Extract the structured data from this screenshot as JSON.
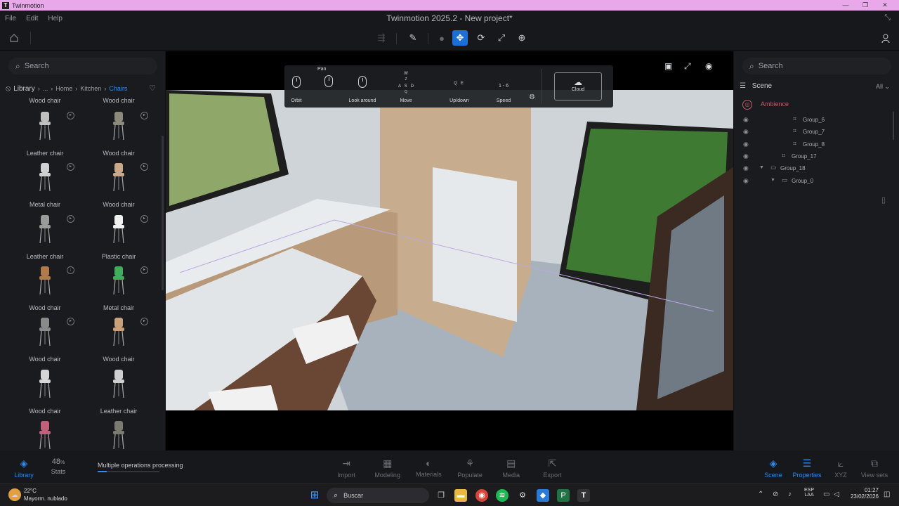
{
  "window": {
    "app_name": "Twinmotion",
    "title": "Twinmotion 2025.2 - New project*",
    "app_icon_letter": "T"
  },
  "menu": [
    "File",
    "Edit",
    "Help"
  ],
  "left_panel": {
    "search_placeholder": "Search",
    "breadcrumb": {
      "library": "Library",
      "ellipsis": "...",
      "home": "Home",
      "kitchen": "Kitchen",
      "current": "Chairs"
    },
    "top_row_labels": [
      "Wood chair",
      "Wood chair"
    ],
    "assets": [
      {
        "name": "Leather chair",
        "color": "#bfbfbf"
      },
      {
        "name": "Wood chair",
        "color": "#8c8a7a"
      },
      {
        "name": "Metal chair",
        "color": "#d0d0d0"
      },
      {
        "name": "Wood chair",
        "color": "#c9a98a"
      },
      {
        "name": "Leather chair",
        "color": "#9a9a9a"
      },
      {
        "name": "Plastic chair",
        "color": "#f1f1f1"
      },
      {
        "name": "Wood chair",
        "color": "#b07a4a"
      },
      {
        "name": "Metal chair",
        "color": "#3fae5a"
      },
      {
        "name": "Wood chair",
        "color": "#8a8a8a"
      },
      {
        "name": "Wood chair",
        "color": "#c8a07a"
      },
      {
        "name": "Wood chair",
        "color": "#d6d6d6"
      },
      {
        "name": "Leather chair",
        "color": "#cfcfcf"
      },
      {
        "name": "",
        "color": "#c0607a"
      },
      {
        "name": "",
        "color": "#7a7a70"
      }
    ]
  },
  "viewport": {
    "nav_hud": {
      "pan": "Pan",
      "orbit": "Orbit",
      "look_around": "Look around",
      "move": "Move",
      "updown": "Up/down",
      "speed": "Speed",
      "speed_value": "1 - 6",
      "cloud": "Cloud",
      "move_keys": [
        "W",
        "A",
        "S",
        "D",
        "Z",
        "Q"
      ],
      "updown_keys": [
        "Q",
        "E"
      ]
    }
  },
  "right_panel": {
    "search_placeholder": "Search",
    "scene_title": "Scene",
    "filter": "All",
    "ambience": "Ambience",
    "tree": [
      {
        "label": "Group_6",
        "indent": 2
      },
      {
        "label": "Group_7",
        "indent": 2
      },
      {
        "label": "Group_8",
        "indent": 2
      },
      {
        "label": "Group_17",
        "indent": 1
      },
      {
        "label": "Group_18",
        "indent": 0
      },
      {
        "label": "Group_0",
        "indent": 1
      }
    ]
  },
  "bottom_bar": {
    "library": "Library",
    "stats_value": "48",
    "stats_unit": "%",
    "stats": "Stats",
    "processing": "Multiple operations processing",
    "progress": 0.15,
    "tools": [
      "Import",
      "Modeling",
      "Materials",
      "Populate",
      "Media",
      "Export"
    ],
    "right": [
      "Scene",
      "Properties",
      "XYZ",
      "View sets"
    ]
  },
  "taskbar": {
    "temperature": "22°C",
    "weather": "Mayorm. nublado",
    "search": "Buscar",
    "lang_top": "ESP",
    "lang_bottom": "LAA",
    "time": "01:27",
    "date": "23/02/2026"
  }
}
